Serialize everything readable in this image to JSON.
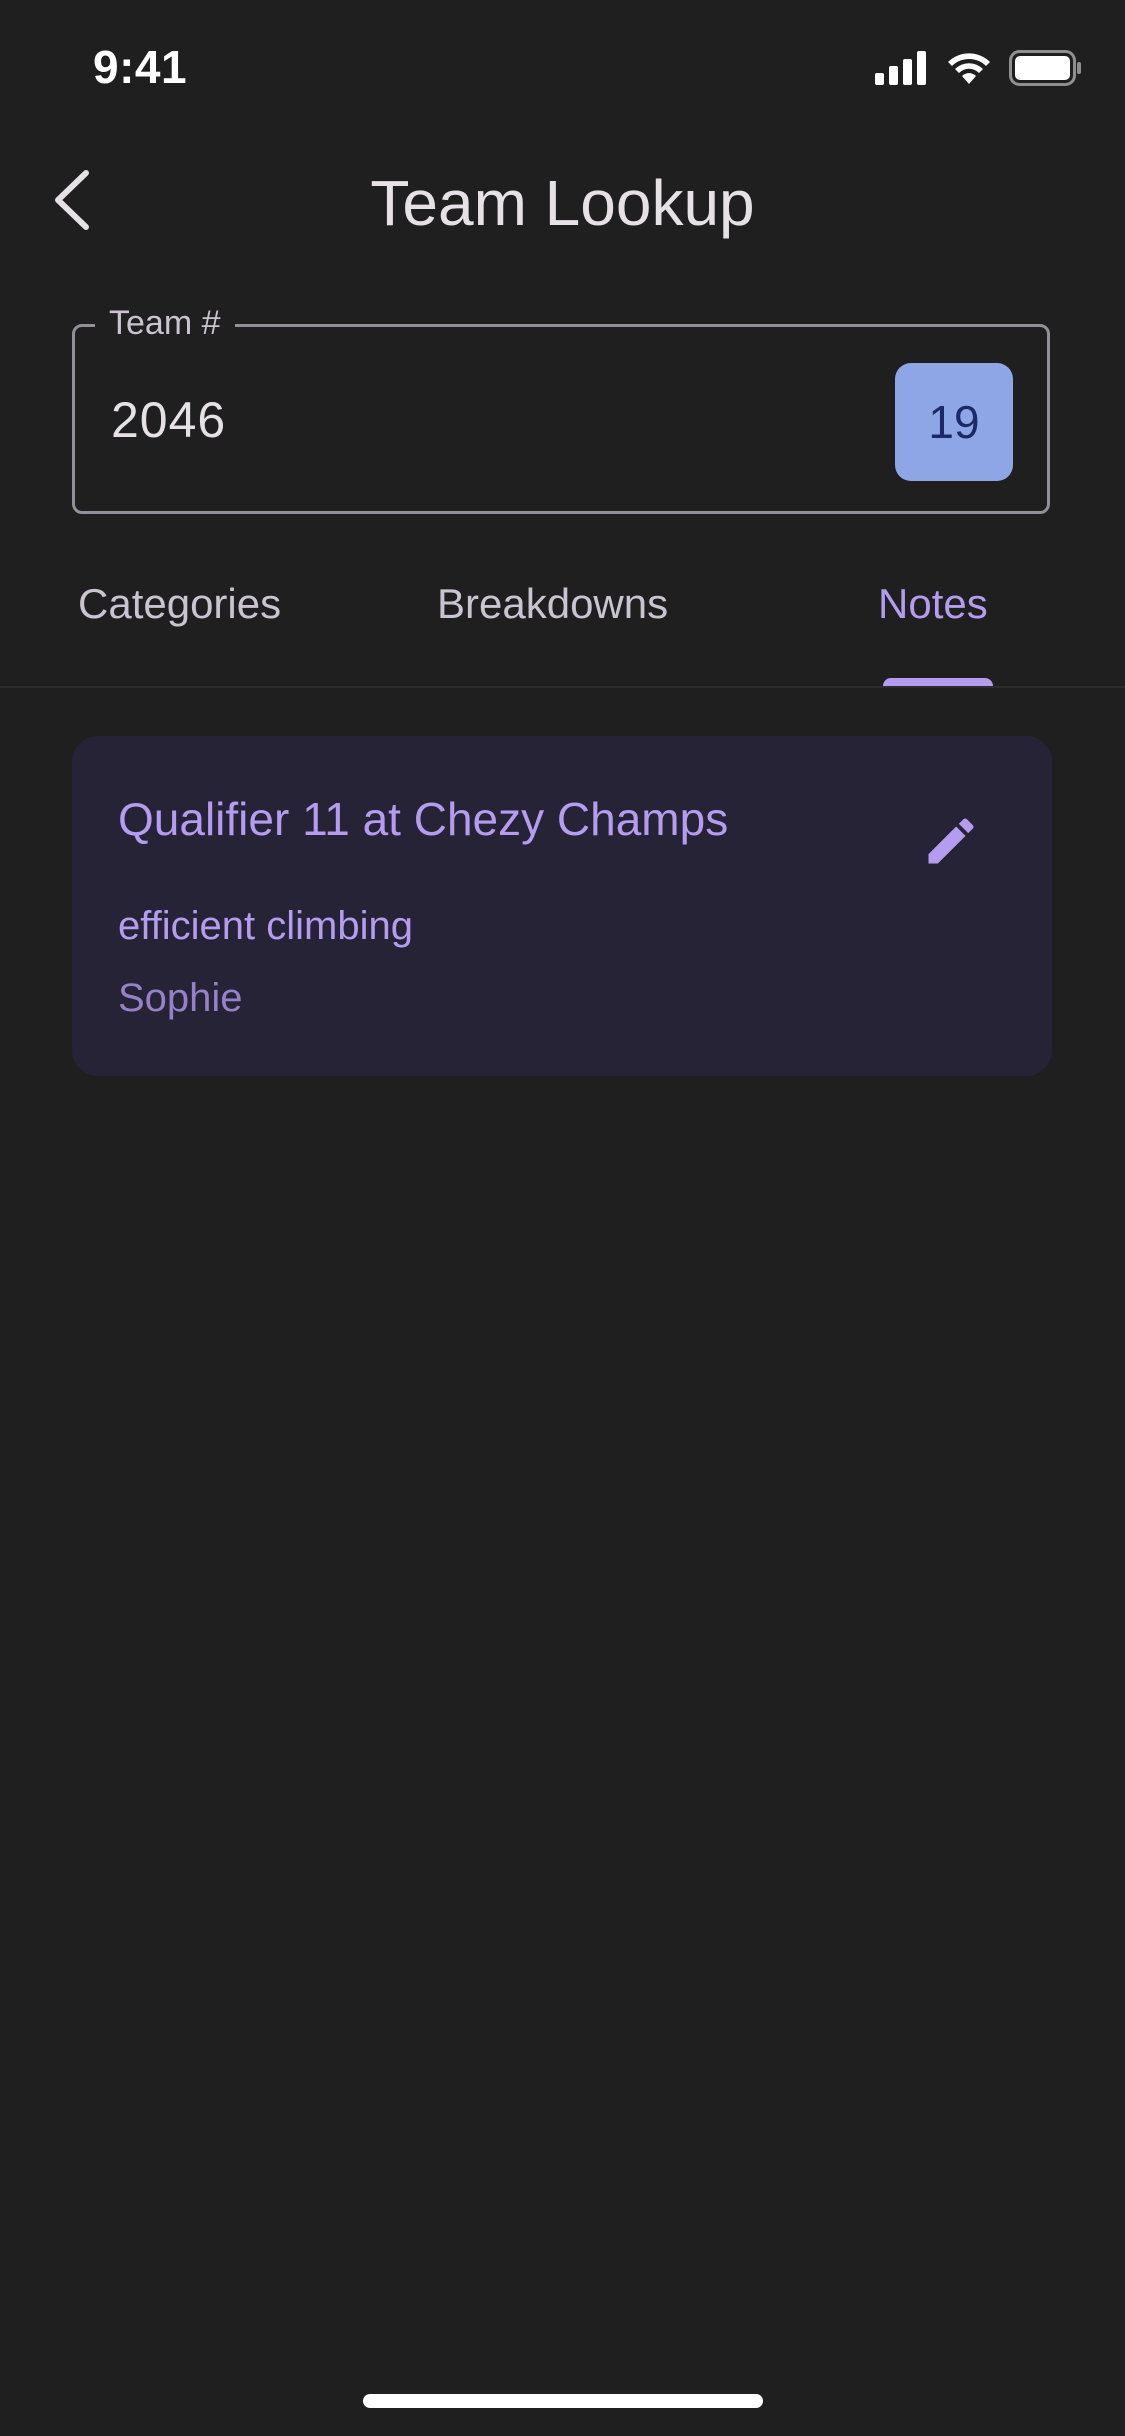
{
  "status_bar": {
    "time": "9:41",
    "icons": [
      "signal-icon",
      "wifi-icon",
      "battery-icon"
    ]
  },
  "app_bar": {
    "back_icon": "chevron-left-icon",
    "title": "Team Lookup"
  },
  "team_field": {
    "label": "Team #",
    "value": "2046",
    "badge": "19"
  },
  "tabs": [
    {
      "label": "Categories",
      "selected": false
    },
    {
      "label": "Breakdowns",
      "selected": false
    },
    {
      "label": "Notes",
      "selected": true
    }
  ],
  "notes": [
    {
      "title": "Qualifier 11 at Chezy Champs",
      "body": "efficient climbing",
      "author": "Sophie",
      "edit_icon": "pencil-icon"
    }
  ],
  "colors": {
    "background": "#1f1f1f",
    "accent": "#b49cf0",
    "badge": "#8fa6e6",
    "card": "#272336"
  }
}
